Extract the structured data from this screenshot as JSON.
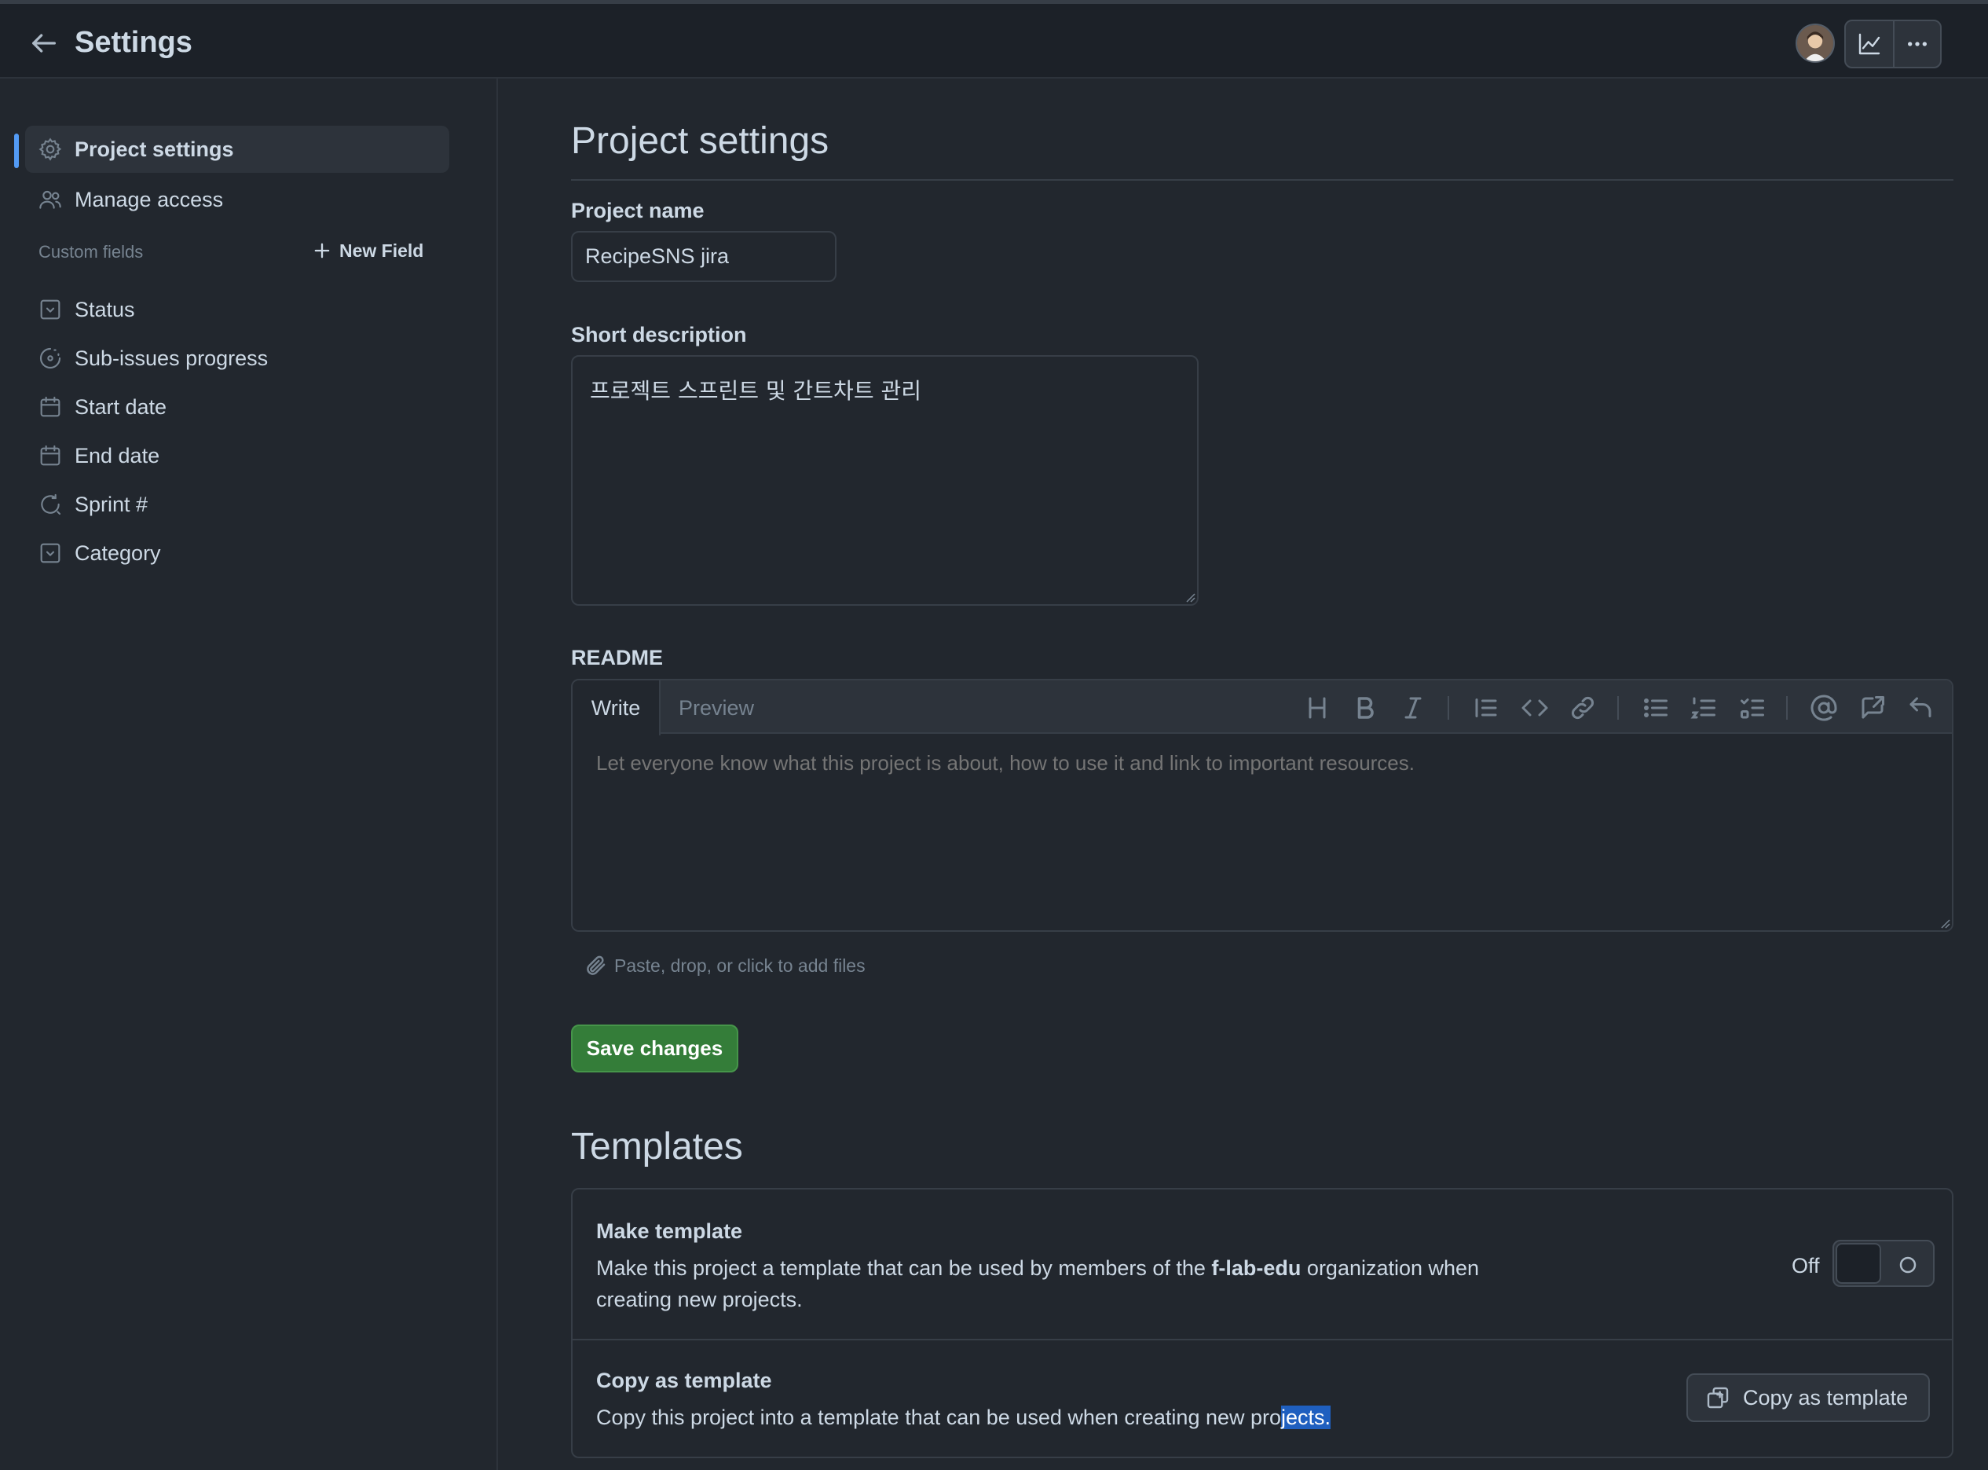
{
  "header": {
    "title": "Settings",
    "back_icon": "arrow-left-icon",
    "avatar_icon": "user-avatar",
    "insights_icon": "graph-icon",
    "more_icon": "kebab-horizontal-icon"
  },
  "sidebar": {
    "items": [
      {
        "label": "Project settings",
        "icon": "gear-icon",
        "active": true
      },
      {
        "label": "Manage access",
        "icon": "people-icon",
        "active": false
      }
    ],
    "custom_fields_label": "Custom fields",
    "new_field_label": "New Field",
    "fields": [
      {
        "label": "Status",
        "icon": "single-select-icon"
      },
      {
        "label": "Sub-issues progress",
        "icon": "progress-icon"
      },
      {
        "label": "Start date",
        "icon": "calendar-icon"
      },
      {
        "label": "End date",
        "icon": "calendar-icon"
      },
      {
        "label": "Sprint #",
        "icon": "iteration-icon"
      },
      {
        "label": "Category",
        "icon": "single-select-icon"
      }
    ]
  },
  "main": {
    "title": "Project settings",
    "project_name_label": "Project name",
    "project_name_value": "RecipeSNS jira",
    "short_description_label": "Short description",
    "short_description_value": "프로젝트 스프린트 및 간트차트 관리",
    "readme_label": "README",
    "readme_tabs": {
      "write": "Write",
      "preview": "Preview"
    },
    "readme_placeholder": "Let everyone know what this project is about, how to use it and link to important resources.",
    "attach_hint": "Paste, drop, or click to add files",
    "save_label": "Save changes"
  },
  "templates": {
    "title": "Templates",
    "make_template": {
      "heading": "Make template",
      "text_before": "Make this project a template that can be used by members of the ",
      "org": "f-lab-edu",
      "text_after": " organization when creating new projects.",
      "toggle_label": "Off",
      "toggle_on": false
    },
    "copy_template": {
      "heading": "Copy as template",
      "text_before": "Copy this project into a template that can be used when creating new pro",
      "text_selected": "jects.",
      "button_label": "Copy as template"
    }
  },
  "colors": {
    "background": "#22272e",
    "header": "#1c2128",
    "accent": "#539bf5",
    "primary_button": "#347d39",
    "text": "#cdd9e5",
    "muted": "#768390"
  }
}
